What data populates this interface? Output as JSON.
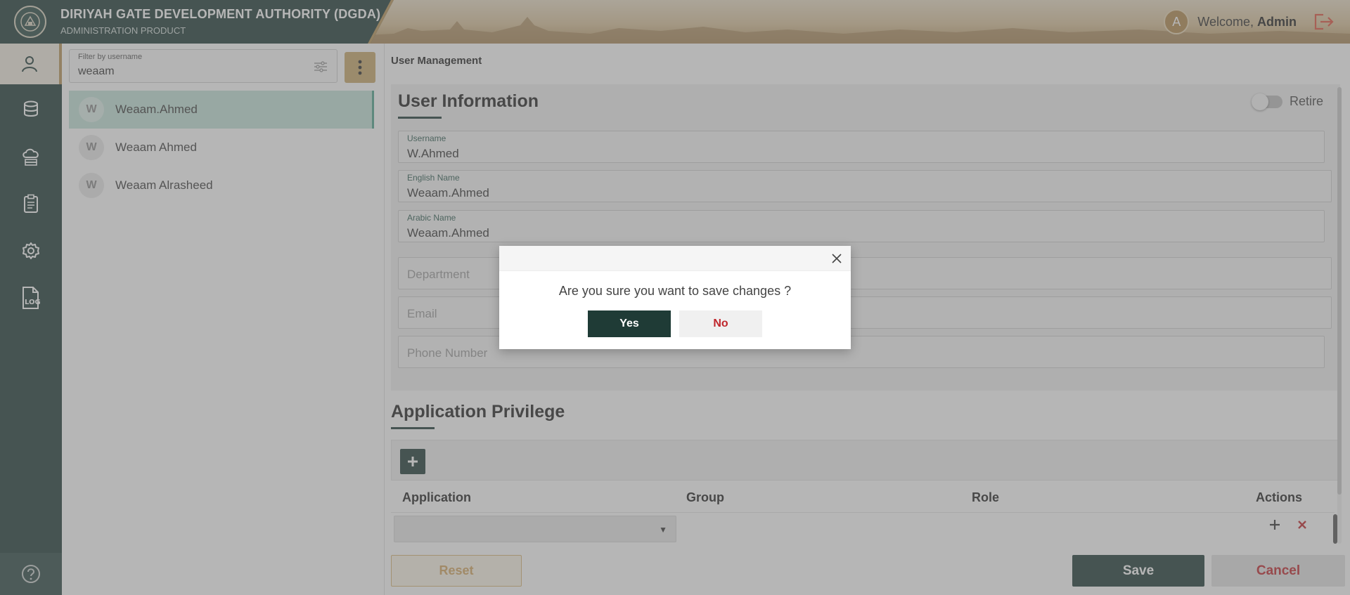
{
  "header": {
    "title": "DIRIYAH GATE DEVELOPMENT AUTHORITY (DGDA)",
    "subtitle": "ADMINISTRATION PRODUCT",
    "avatar_letter": "A",
    "welcome_prefix": "Welcome,",
    "user_name": "Admin"
  },
  "sidebar": {
    "items": [
      {
        "icon": "user-icon",
        "active": true
      },
      {
        "icon": "database-icon",
        "active": false
      },
      {
        "icon": "cloud-server-icon",
        "active": false
      },
      {
        "icon": "clipboard-icon",
        "active": false
      },
      {
        "icon": "gear-icon",
        "active": false
      },
      {
        "icon": "log-file-icon",
        "active": false
      }
    ],
    "help_icon": "help-icon"
  },
  "filter": {
    "label": "Filter by username",
    "value": "weaam"
  },
  "users": [
    {
      "letter": "W",
      "name": "Weaam.Ahmed",
      "selected": true
    },
    {
      "letter": "W",
      "name": "Weaam Ahmed",
      "selected": false
    },
    {
      "letter": "W",
      "name": "Weaam Alrasheed",
      "selected": false
    }
  ],
  "breadcrumb": "User Management",
  "user_info": {
    "title": "User Information",
    "retire_label": "Retire",
    "fields": {
      "username": {
        "label": "Username",
        "value": "W.Ahmed"
      },
      "english_name": {
        "label": "English Name",
        "value": "Weaam.Ahmed"
      },
      "arabic_name": {
        "label": "Arabic Name",
        "value": "Weaam.Ahmed"
      },
      "department": {
        "placeholder": "Department"
      },
      "email": {
        "placeholder": "Email"
      },
      "phone": {
        "placeholder": "Phone Number"
      }
    }
  },
  "privilege": {
    "title": "Application Privilege",
    "columns": [
      "Application",
      "Group",
      "Role",
      "Actions"
    ]
  },
  "buttons": {
    "reset": "Reset",
    "save": "Save",
    "cancel": "Cancel"
  },
  "dialog": {
    "message": "Are you sure you want to save changes ?",
    "yes": "Yes",
    "no": "No"
  },
  "colors": {
    "primary": "#1f3b36",
    "accent_gold": "#b89458",
    "danger": "#c0262c"
  }
}
